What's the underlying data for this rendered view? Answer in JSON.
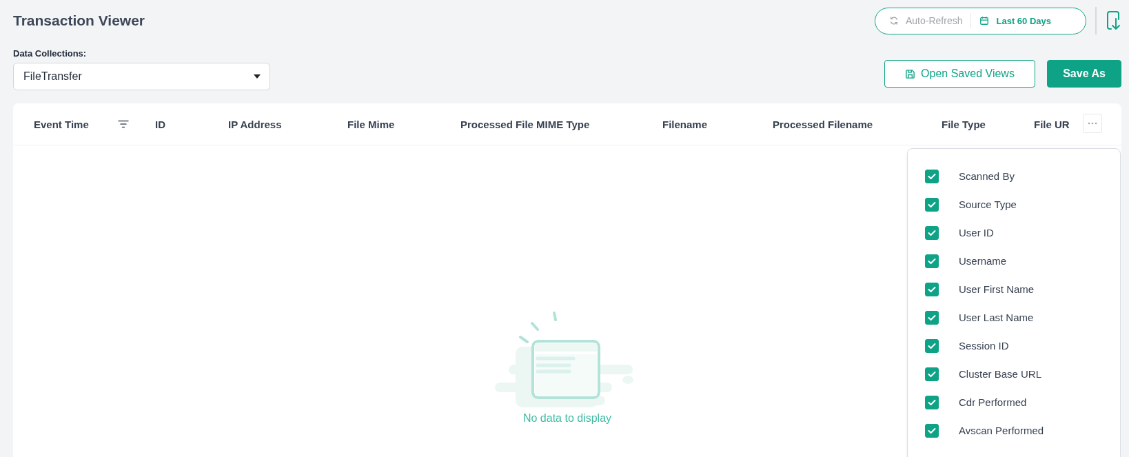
{
  "page": {
    "title": "Transaction Viewer"
  },
  "toolbar": {
    "auto_refresh": {
      "label": "Auto-Refresh",
      "on": false
    },
    "date_range": "Last 60 Days"
  },
  "data_collections": {
    "label": "Data Collections:",
    "value": "FileTransfer"
  },
  "buttons": [
    {
      "label": "Open Saved Views",
      "kind": "outline"
    },
    {
      "label": "Save As",
      "kind": "primary"
    }
  ],
  "table": {
    "columns": [
      {
        "label": "Event Time",
        "filter": true
      },
      {
        "label": "ID",
        "filter": false
      },
      {
        "label": "IP Address",
        "filter": false
      },
      {
        "label": "File Mime",
        "filter": false
      },
      {
        "label": "Processed File MIME Type",
        "filter": false
      },
      {
        "label": "Filename",
        "filter": false
      },
      {
        "label": "Processed Filename",
        "filter": false
      },
      {
        "label": "File Type",
        "filter": false
      },
      {
        "label": "File UR",
        "filter": false
      }
    ],
    "empty_message": "No data to display"
  },
  "column_menu": {
    "items": [
      {
        "label": "Scanned By",
        "checked": true
      },
      {
        "label": "Source Type",
        "checked": true
      },
      {
        "label": "User ID",
        "checked": true
      },
      {
        "label": "Username",
        "checked": true
      },
      {
        "label": "User First Name",
        "checked": true
      },
      {
        "label": "User Last Name",
        "checked": true
      },
      {
        "label": "Session ID",
        "checked": true
      },
      {
        "label": "Cluster Base URL",
        "checked": true
      },
      {
        "label": "Cdr Performed",
        "checked": true
      },
      {
        "label": "Avscan Performed",
        "checked": true
      }
    ]
  }
}
